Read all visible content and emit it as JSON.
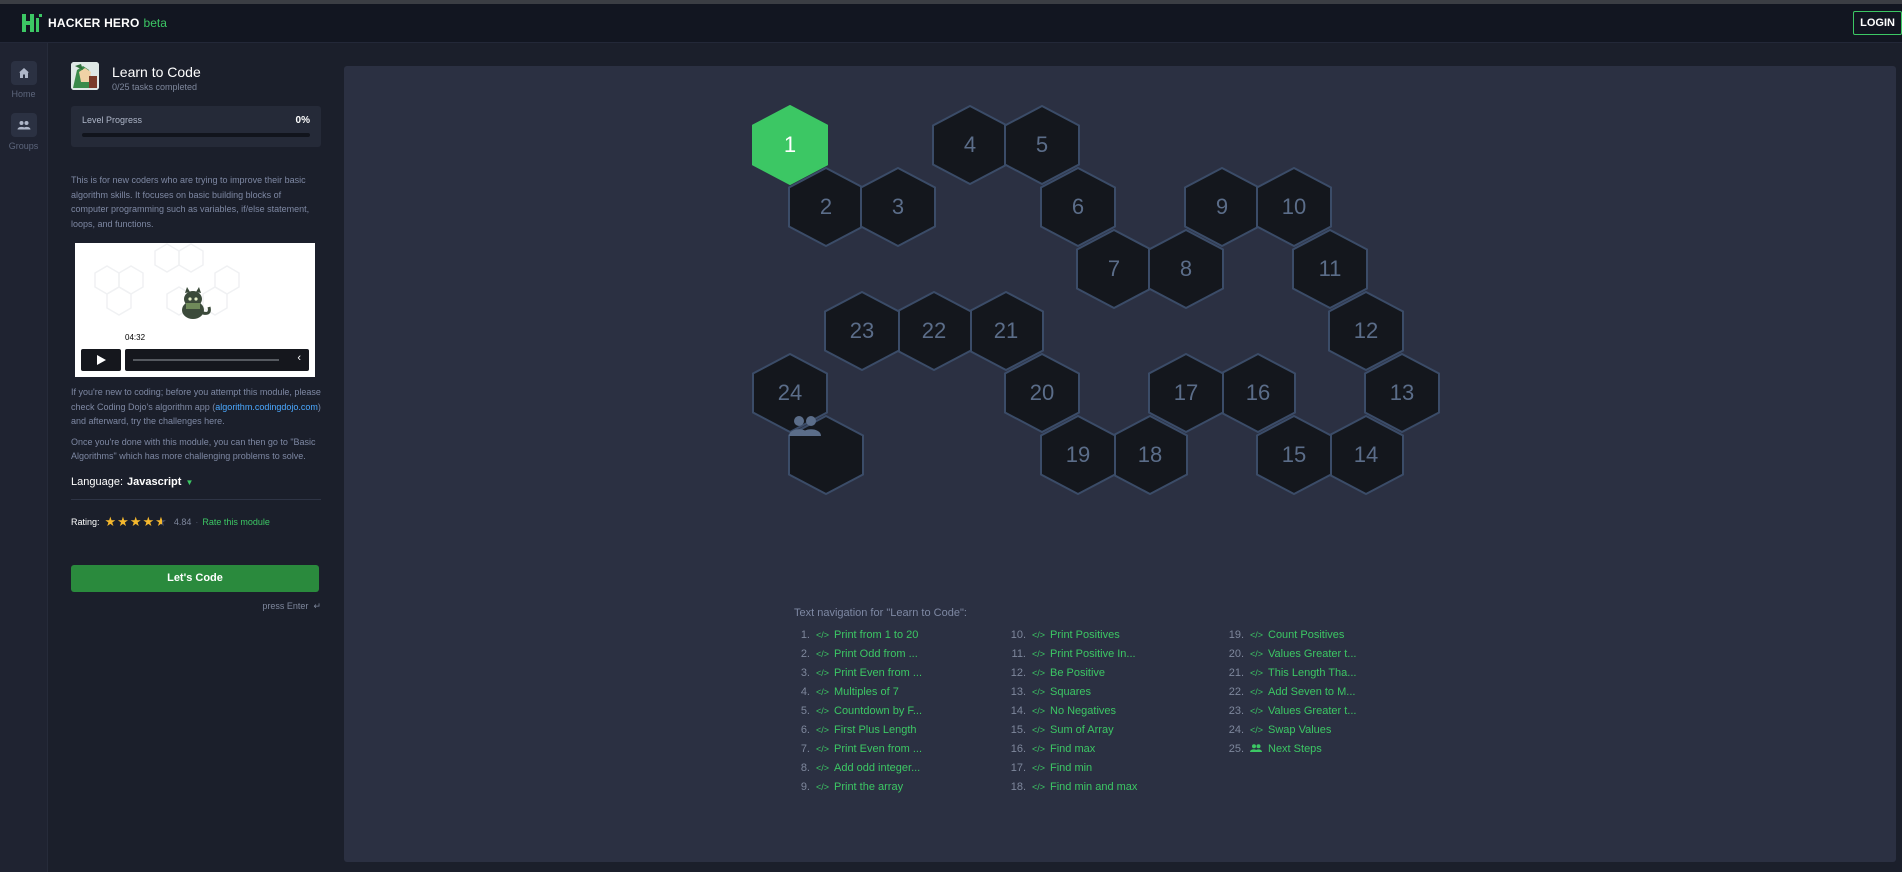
{
  "app": {
    "name": "HACKER HERO",
    "badge": "beta",
    "login_label": "LOGIN"
  },
  "nav": {
    "items": [
      {
        "label": "Home",
        "icon": "home-icon"
      },
      {
        "label": "Groups",
        "icon": "groups-icon"
      }
    ]
  },
  "module": {
    "title": "Learn to Code",
    "subtitle": "0/25 tasks completed",
    "progress_label": "Level Progress",
    "progress_value": "0%",
    "progress_fraction": 0,
    "description": "This is for new coders who are trying to improve their basic algorithm skills. It focuses on basic building blocks of computer programming such as variables, if/else statement, loops, and functions.",
    "video_time": "04:32",
    "note1_before": "If you're new to coding; before you attempt this module, please check Coding Dojo's algorithm app (",
    "note1_link": "algorithm.codingdojo.com",
    "note1_after": ") and afterward, try the challenges here.",
    "note2": "Once you're done with this module, you can then go to \"Basic Algorithms\" which has more challenging problems to solve.",
    "language_label": "Language:",
    "language_value": "Javascript",
    "rating_label": "Rating:",
    "rating_value": "4.84",
    "rating_stars": 4.84,
    "rate_link": "Rate this module",
    "cta_label": "Let's Code",
    "enter_hint": "press Enter"
  },
  "hexes": [
    {
      "label": "1",
      "active": true
    },
    {
      "label": "2"
    },
    {
      "label": "3"
    },
    {
      "label": "4"
    },
    {
      "label": "5"
    },
    {
      "label": "6"
    },
    {
      "label": "7"
    },
    {
      "label": "8"
    },
    {
      "label": "9"
    },
    {
      "label": "10"
    },
    {
      "label": "11"
    },
    {
      "label": "12"
    },
    {
      "label": "13"
    },
    {
      "label": "14"
    },
    {
      "label": "15"
    },
    {
      "label": "16"
    },
    {
      "label": "17"
    },
    {
      "label": "18"
    },
    {
      "label": "19"
    },
    {
      "label": "20"
    },
    {
      "label": "21"
    },
    {
      "label": "22"
    },
    {
      "label": "23"
    },
    {
      "label": "24"
    },
    {
      "label": "",
      "icon": "people-icon"
    }
  ],
  "text_nav": {
    "title": "Text navigation for \"Learn to Code\":",
    "items": [
      {
        "num": "1.",
        "label": "Print from 1 to 20"
      },
      {
        "num": "2.",
        "label": "Print Odd from ..."
      },
      {
        "num": "3.",
        "label": "Print Even from ..."
      },
      {
        "num": "4.",
        "label": "Multiples of 7"
      },
      {
        "num": "5.",
        "label": "Countdown by F..."
      },
      {
        "num": "6.",
        "label": "First Plus Length"
      },
      {
        "num": "7.",
        "label": "Print Even from ..."
      },
      {
        "num": "8.",
        "label": "Add odd integer..."
      },
      {
        "num": "9.",
        "label": "Print the array"
      },
      {
        "num": "10.",
        "label": "Print Positives"
      },
      {
        "num": "11.",
        "label": "Print Positive In..."
      },
      {
        "num": "12.",
        "label": "Be Positive"
      },
      {
        "num": "13.",
        "label": "Squares"
      },
      {
        "num": "14.",
        "label": "No Negatives"
      },
      {
        "num": "15.",
        "label": "Sum of Array"
      },
      {
        "num": "16.",
        "label": "Find max"
      },
      {
        "num": "17.",
        "label": "Find min"
      },
      {
        "num": "18.",
        "label": "Find min and max"
      },
      {
        "num": "19.",
        "label": "Count Positives"
      },
      {
        "num": "20.",
        "label": "Values Greater t..."
      },
      {
        "num": "21.",
        "label": "This Length Tha..."
      },
      {
        "num": "22.",
        "label": "Add Seven to M..."
      },
      {
        "num": "23.",
        "label": "Values Greater t..."
      },
      {
        "num": "24.",
        "label": "Swap Values"
      },
      {
        "num": "25.",
        "label": "Next Steps",
        "icon": "people-icon"
      }
    ]
  },
  "colors": {
    "accent": "#3cc764",
    "hex_fill": "#14171d",
    "hex_stroke": "#3b4c68",
    "panel_bg": "#2b3042"
  }
}
